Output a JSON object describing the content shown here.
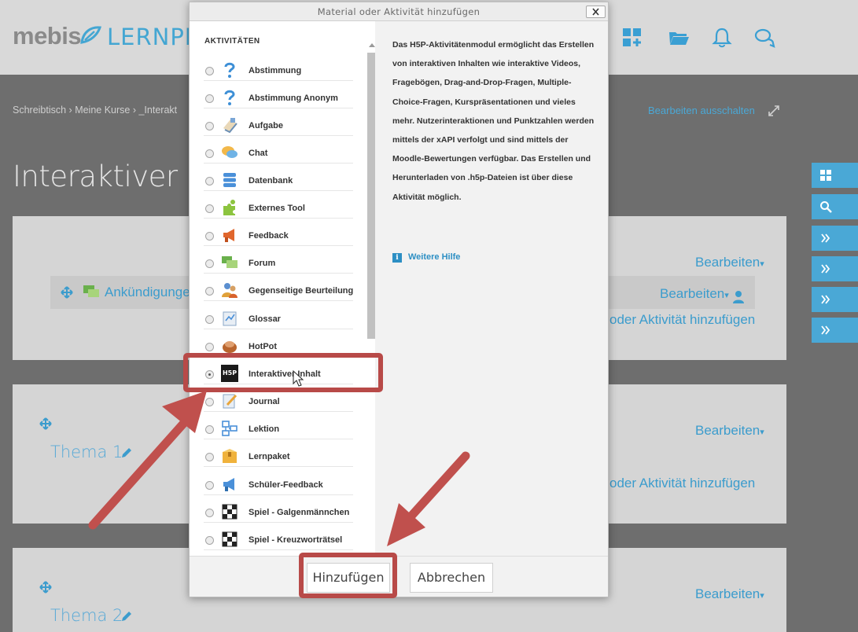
{
  "header": {
    "logo_text": "mebis",
    "logo_sub": "LERNPLA"
  },
  "breadcrumb": {
    "text": "Schreibtisch › Meine Kurse › _Interakt"
  },
  "edit_toggle": "Bearbeiten ausschalten",
  "page_title": "Interaktiver Inh",
  "course": {
    "edit_label": "Bearbeiten",
    "edit_arrow": "▾",
    "announcement": "Ankündigunge",
    "add_activity": "oder Aktivität hinzufügen",
    "topic1": "Thema 1",
    "topic2": "Thema 2"
  },
  "modal": {
    "title": "Material oder Aktivität hinzufügen",
    "close_label": "×",
    "section": "AKTIVITÄTEN",
    "items": [
      {
        "label": "Abstimmung",
        "icon": "question-icon"
      },
      {
        "label": "Abstimmung Anonym",
        "icon": "question-icon"
      },
      {
        "label": "Aufgabe",
        "icon": "assignment-icon"
      },
      {
        "label": "Chat",
        "icon": "chat-icon"
      },
      {
        "label": "Datenbank",
        "icon": "database-icon"
      },
      {
        "label": "Externes Tool",
        "icon": "puzzle-icon"
      },
      {
        "label": "Feedback",
        "icon": "megaphone-icon"
      },
      {
        "label": "Forum",
        "icon": "forum-icon"
      },
      {
        "label": "Gegenseitige Beurteilung",
        "icon": "people-icon"
      },
      {
        "label": "Glossar",
        "icon": "glossary-icon"
      },
      {
        "label": "HotPot",
        "icon": "hotpot-icon"
      },
      {
        "label": "Interaktiver Inhalt",
        "icon": "h5p-icon",
        "selected": true
      },
      {
        "label": "Journal",
        "icon": "journal-icon"
      },
      {
        "label": "Lektion",
        "icon": "lesson-icon"
      },
      {
        "label": "Lernpaket",
        "icon": "package-icon"
      },
      {
        "label": "Schüler-Feedback",
        "icon": "megaphone-blue-icon"
      },
      {
        "label": "Spiel - Galgenmännchen",
        "icon": "checker-icon"
      },
      {
        "label": "Spiel - Kreuzworträtsel",
        "icon": "checker-icon"
      }
    ],
    "h5p_badge": "H5P",
    "description": "Das H5P-Aktivitätenmodul ermöglicht das Erstellen von interaktiven Inhalten wie interaktive Videos, Fragebögen, Drag-and-Drop-Fragen, Multiple-Choice-Fragen, Kurspräsentationen und vieles mehr. Nutzerinteraktionen und Punktzahlen werden mittels der xAPI verfolgt und sind mittels der Moodle-Bewertungen verfügbar. Das Erstellen und Herunterladen von .h5p-Dateien ist über diese Aktivität möglich.",
    "help_badge": "i",
    "help_link": "Weitere Hilfe",
    "add_button": "Hinzufügen",
    "cancel_button": "Abbrechen"
  },
  "colors": {
    "accent": "#4aa8d6",
    "highlight": "#b84a48",
    "arrow": "#c0504d"
  }
}
